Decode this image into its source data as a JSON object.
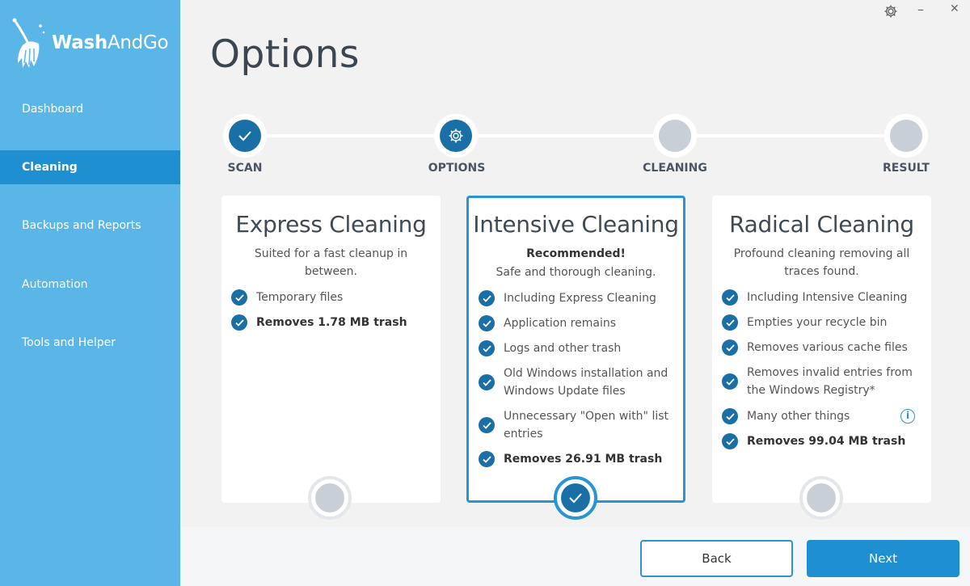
{
  "app": {
    "name_bold": "Wash",
    "name_light": "AndGo"
  },
  "colors": {
    "sidebar": "#5bb6e8",
    "sidebar_active": "#1e8fd0",
    "accent": "#1b6fa7",
    "selected_border": "#2a94d4"
  },
  "window_controls": {
    "settings_icon": "gear-icon",
    "minimize": "–",
    "close": "✕"
  },
  "sidebar": {
    "items": [
      {
        "label": "Dashboard",
        "active": false
      },
      {
        "label": "Cleaning",
        "active": true
      },
      {
        "label": "Backups and Reports",
        "active": false
      },
      {
        "label": "Automation",
        "active": false
      },
      {
        "label": "Tools and Helper",
        "active": false
      }
    ]
  },
  "page_title": "Options",
  "stepper": {
    "steps": [
      {
        "label": "SCAN",
        "state": "done"
      },
      {
        "label": "OPTIONS",
        "state": "current"
      },
      {
        "label": "CLEANING",
        "state": "pending"
      },
      {
        "label": "RESULT",
        "state": "pending"
      }
    ]
  },
  "cards": [
    {
      "title": "Express Cleaning",
      "subtitle": "Suited for a fast cleanup in between.",
      "selected": false,
      "features": [
        {
          "text": "Temporary files",
          "bold": false
        },
        {
          "text": "Removes 1.78 MB trash",
          "bold": true
        }
      ]
    },
    {
      "title": "Intensive Cleaning",
      "recommended": "Recommended!",
      "subtitle": "Safe and thorough cleaning.",
      "selected": true,
      "features": [
        {
          "text": "Including Express Cleaning",
          "bold": false
        },
        {
          "text": "Application remains",
          "bold": false
        },
        {
          "text": "Logs and other trash",
          "bold": false
        },
        {
          "text": "Old Windows installation and Windows Update files",
          "bold": false
        },
        {
          "text": "Unnecessary \"Open with\" list entries",
          "bold": false
        },
        {
          "text": "Removes 26.91 MB trash",
          "bold": true
        }
      ]
    },
    {
      "title": "Radical Cleaning",
      "subtitle": "Profound cleaning removing all traces found.",
      "selected": false,
      "features": [
        {
          "text": "Including Intensive Cleaning",
          "bold": false
        },
        {
          "text": "Empties your recycle bin",
          "bold": false
        },
        {
          "text": "Removes various cache files",
          "bold": false
        },
        {
          "text": "Removes invalid entries from the Windows Registry*",
          "bold": false
        },
        {
          "text": "Many other things",
          "bold": false
        },
        {
          "text": "Removes 99.04 MB trash",
          "bold": true
        }
      ]
    }
  ],
  "info_icon_label": "i",
  "buttons": {
    "back": "Back",
    "next": "Next"
  }
}
